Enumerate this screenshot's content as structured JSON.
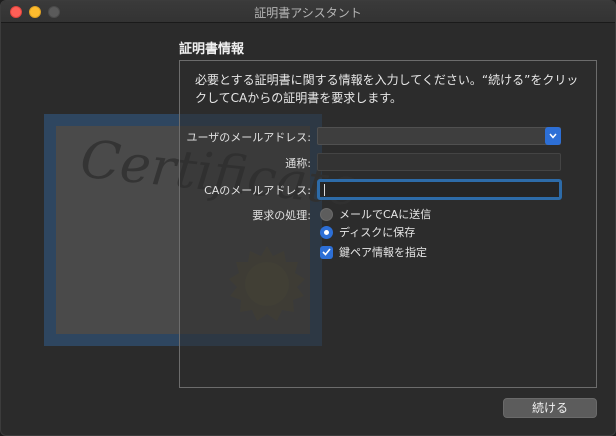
{
  "window": {
    "title": "証明書アシスタント"
  },
  "certificate": {
    "backdrop_word": "Certificate"
  },
  "section": {
    "title": "証明書情報",
    "description": "必要とする証明書に関する情報を入力してください。“続ける”をクリックしてCAからの証明書を要求します。"
  },
  "form": {
    "user_email": {
      "label": "ユーザのメールアドレス:",
      "value": ""
    },
    "common_name": {
      "label": "通称:",
      "value": ""
    },
    "ca_email": {
      "label": "CAのメールアドレス:",
      "value": ""
    },
    "request": {
      "label": "要求の処理:",
      "options": [
        {
          "label": "メールでCAに送信",
          "selected": false
        },
        {
          "label": "ディスクに保存",
          "selected": true
        }
      ]
    },
    "key_pair": {
      "label": "鍵ペア情報を指定",
      "checked": true
    }
  },
  "buttons": {
    "continue": "続ける"
  },
  "colors": {
    "accent": "#2d6fd6",
    "focus": "#2d6ba8",
    "background": "#2b2b2b"
  }
}
